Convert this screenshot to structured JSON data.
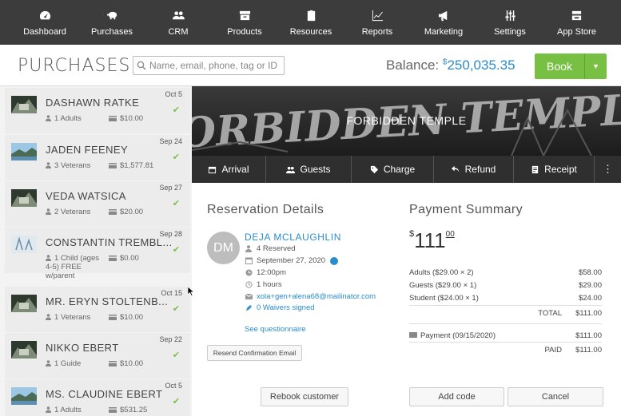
{
  "nav": [
    {
      "label": "Dashboard",
      "icon": "dashboard-icon"
    },
    {
      "label": "Purchases",
      "icon": "piggy-bank-icon"
    },
    {
      "label": "CRM",
      "icon": "users-icon"
    },
    {
      "label": "Products",
      "icon": "box-icon"
    },
    {
      "label": "Resources",
      "icon": "clipboard-icon"
    },
    {
      "label": "Reports",
      "icon": "line-chart-icon"
    },
    {
      "label": "Marketing",
      "icon": "megaphone-icon"
    },
    {
      "label": "Settings",
      "icon": "sliders-icon"
    },
    {
      "label": "App Store",
      "icon": "store-icon"
    }
  ],
  "header": {
    "title": "PURCHASES",
    "search_placeholder": "Name, email, phone, tag or ID",
    "balance_label": "Balance: ",
    "balance_currency": "$",
    "balance_value": "250,035.35",
    "book_label": "Book"
  },
  "purchases": [
    {
      "name": "DASHAWN RATKE",
      "date": "Oct 5",
      "guests": "1 Adults",
      "price": "$10.00",
      "thumb": "temple"
    },
    {
      "name": "JADEN FEENEY",
      "date": "Sep 24",
      "guests": "3 Veterans",
      "price": "$1,577.81",
      "thumb": "lake"
    },
    {
      "name": "VEDA WATSICA",
      "date": "Sep 27",
      "guests": "2 Veterans",
      "price": "$20.00",
      "thumb": "temple"
    },
    {
      "name": "CONSTANTIN TREMBL...",
      "date": "Sep 28",
      "guests": "1 Child (ages 4-5) FREE w/parent",
      "price": "$0.00",
      "thumb": "sketch"
    },
    {
      "name": "MR. ERYN STOLTENB...",
      "date": "Oct 15",
      "guests": "1 Veterans",
      "price": "$10.00",
      "thumb": "temple"
    },
    {
      "name": "NIKKO EBERT",
      "date": "Sep 22",
      "guests": "1 Guide",
      "price": "$10.00",
      "thumb": "temple"
    },
    {
      "name": "MS. CLAUDINE EBERT",
      "date": "Oct 5",
      "guests": "1 Adults",
      "price": "$531.25",
      "thumb": "lake"
    }
  ],
  "banner": {
    "title": "FORBIDDEN TEMPLE",
    "art_text": "FORBIDDEN TEMPLE"
  },
  "actions": [
    {
      "label": "Arrival",
      "icon": "calendar-icon"
    },
    {
      "label": "Guests",
      "icon": "users-icon"
    },
    {
      "label": "Charge",
      "icon": "tag-icon"
    },
    {
      "label": "Refund",
      "icon": "undo-icon"
    },
    {
      "label": "Receipt",
      "icon": "receipt-icon"
    }
  ],
  "reservation": {
    "heading": "Reservation Details",
    "avatar_initials": "DM",
    "customer_name": "DEJA MCLAUGHLIN",
    "reserved": "4 Reserved",
    "date": "September 27, 2020",
    "time": "12:00pm",
    "duration": "1 hours",
    "email": "xola+gen+alena68@mailinator.com",
    "waivers": "0 Waivers signed",
    "questionnaire": "See questionnaire",
    "resend_label": "Resend Confirmation Email",
    "rebook_label": "Rebook customer"
  },
  "payment": {
    "heading": "Payment Summary",
    "currency": "$",
    "total_whole": "111",
    "total_cents": "00",
    "lines": [
      {
        "label": "Adults ($29.00 × 2)",
        "amount": "$58.00"
      },
      {
        "label": "Guests ($29.00 × 1)",
        "amount": "$29.00"
      },
      {
        "label": "Student ($24.00 × 1)",
        "amount": "$24.00"
      }
    ],
    "total_label": "TOTAL",
    "total_amount": "$111.00",
    "payment_label": "Payment (09/15/2020)",
    "payment_amount": "$111.00",
    "paid_label": "PAID",
    "paid_amount": "$111.00",
    "addcode_label": "Add code",
    "cancel_label": "Cancel"
  },
  "colors": {
    "accent": "#2b8ccc",
    "book": "#77c043",
    "nav_bg": "#3c3c3c",
    "check": "#7bbf45"
  }
}
